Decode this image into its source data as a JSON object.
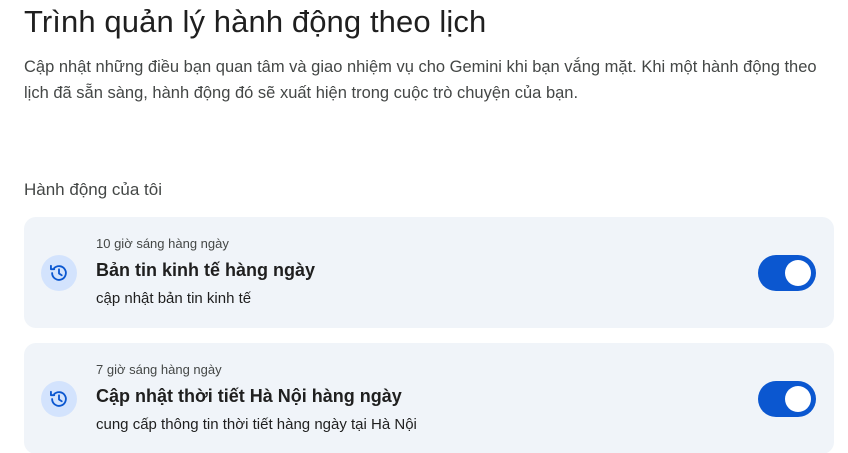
{
  "page": {
    "title": "Trình quản lý hành động theo lịch",
    "description": "Cập nhật những điều bạn quan tâm và giao nhiệm vụ cho Gemini khi bạn vắng mặt. Khi một hành động theo lịch đã sẵn sàng, hành động đó sẽ xuất hiện trong cuộc trò chuyện của bạn."
  },
  "section": {
    "heading": "Hành động của tôi"
  },
  "actions": [
    {
      "schedule": "10 giờ sáng hàng ngày",
      "title": "Bản tin kinh tế hàng ngày",
      "subtitle": "cập nhật bản tin kinh tế",
      "icon": "scheduled-history-icon",
      "enabled": true
    },
    {
      "schedule": "7 giờ sáng hàng ngày",
      "title": "Cập nhật thời tiết Hà Nội hàng ngày",
      "subtitle": "cung cấp thông tin thời tiết hàng ngày tại Hà Nội",
      "icon": "scheduled-history-icon",
      "enabled": true
    }
  ],
  "colors": {
    "accent": "#0b57d0",
    "card_background": "#f0f4f9",
    "icon_background": "#d3e3fd",
    "icon_foreground": "#0b57d0"
  }
}
